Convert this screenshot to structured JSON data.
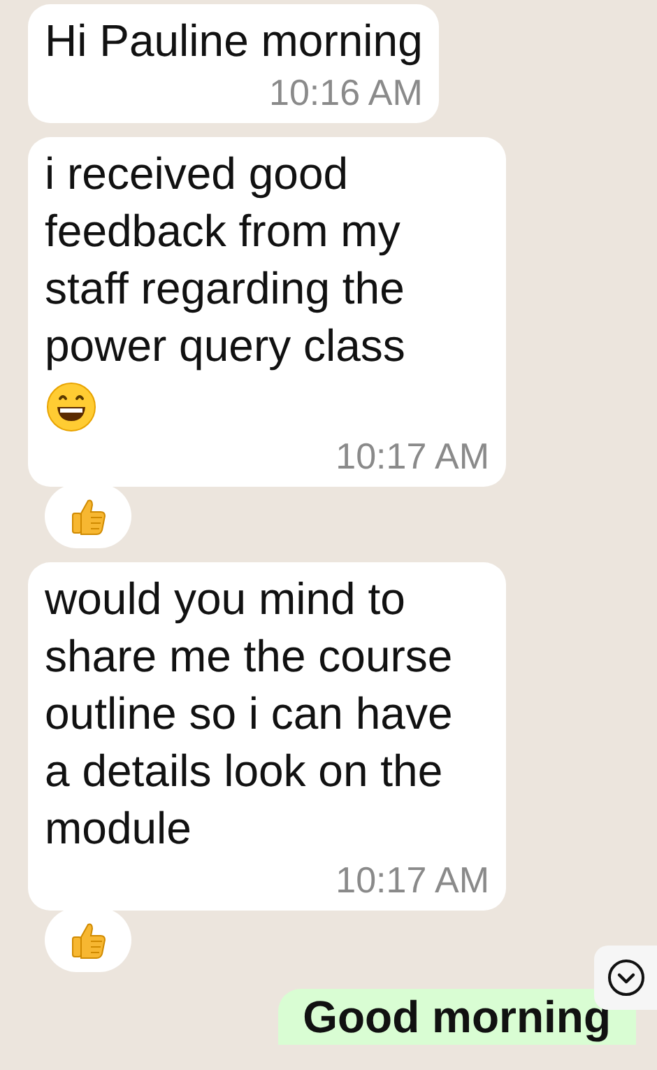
{
  "messages": [
    {
      "kind": "incoming",
      "text": "Hi Pauline morning",
      "time": "10:16 AM",
      "emoji": false,
      "reacted": false
    },
    {
      "kind": "incoming",
      "text": "i received good feedback from my staff regarding the power query class",
      "time": "10:17 AM",
      "emoji": true,
      "reacted": true
    },
    {
      "kind": "incoming",
      "text": "would you mind to share me the course outline so i can have a details look on the module",
      "time": "10:17 AM",
      "emoji": false,
      "reacted": true
    },
    {
      "kind": "outgoing",
      "text": "Good morning"
    }
  ]
}
